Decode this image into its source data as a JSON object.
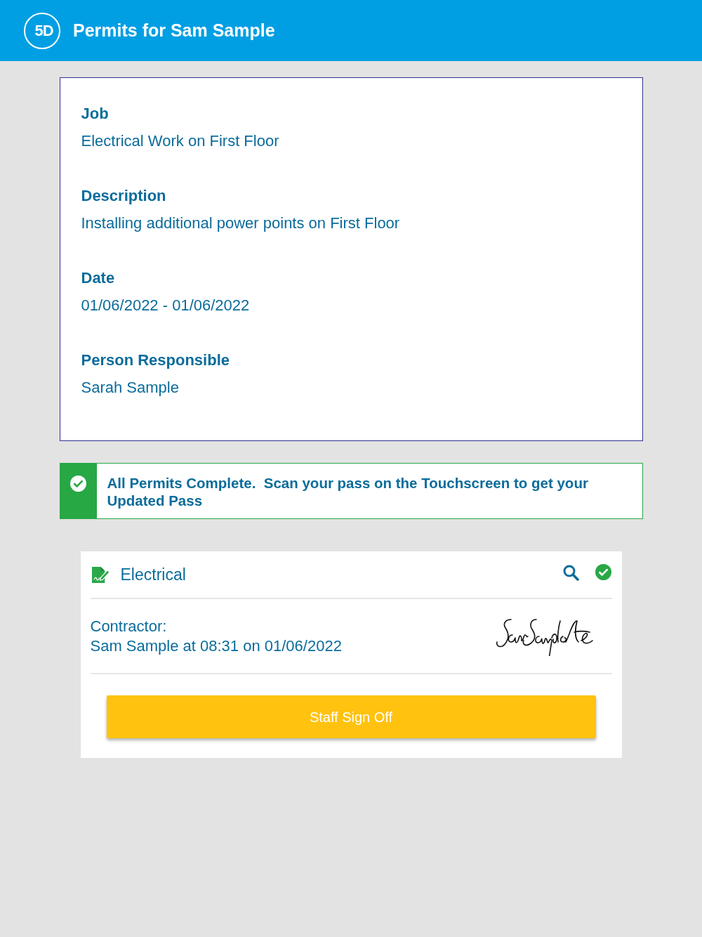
{
  "header": {
    "logo_text": "5D",
    "title": "Permits for Sam Sample"
  },
  "details": [
    {
      "label": "Job",
      "value": "Electrical Work on First Floor"
    },
    {
      "label": "Description",
      "value": "Installing additional power points on First Floor"
    },
    {
      "label": "Date",
      "value": "01/06/2022 - 01/06/2022"
    },
    {
      "label": "Person Responsible",
      "value": "Sarah Sample"
    }
  ],
  "alert": {
    "kind": "success",
    "message": "All Permits Complete.  Scan your pass on the Touchscreen to get your Updated Pass"
  },
  "permits": [
    {
      "name": "Electrical",
      "complete": true,
      "contractor_label": "Contractor:",
      "contractor_value": "Sam Sample at 08:31 on 01/06/2022",
      "signed": true,
      "action": "Staff Sign Off"
    }
  ]
}
